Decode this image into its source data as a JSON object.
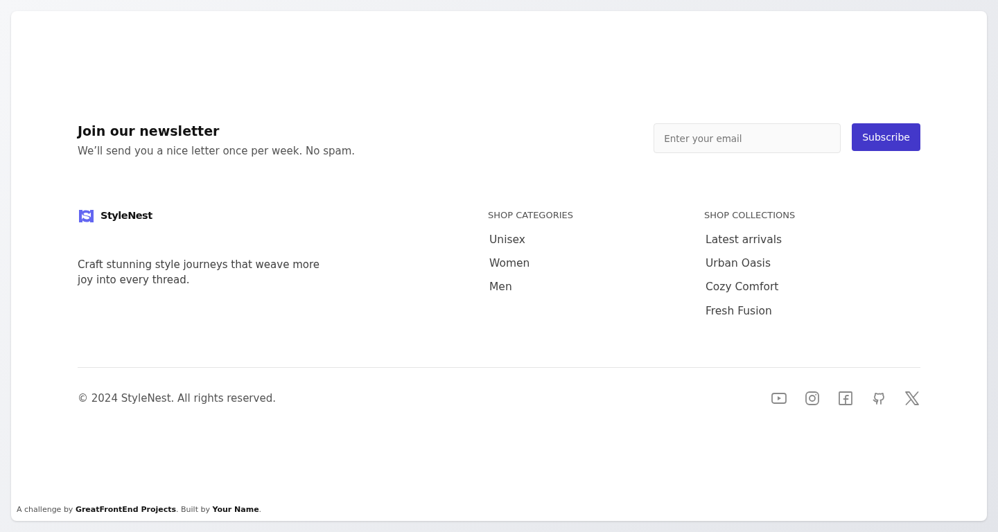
{
  "newsletter": {
    "title": "Join our newsletter",
    "subtitle": "We’ll send you a nice letter once per week. No spam.",
    "email": {
      "placeholder": "Enter your email"
    },
    "button": "Subscribe"
  },
  "brand": {
    "name": "StyleNest",
    "tagline": "Craft stunning style journeys that weave more joy into every thread."
  },
  "columns": [
    {
      "heading": "SHOP CATEGORIES",
      "links": [
        "Unisex",
        "Women",
        "Men"
      ]
    },
    {
      "heading": "SHOP COLLECTIONS",
      "links": [
        "Latest arrivals",
        "Urban Oasis",
        "Cozy Comfort",
        "Fresh Fusion"
      ]
    }
  ],
  "copyright": "© 2024 StyleNest. All rights reserved.",
  "social": [
    {
      "kind": "youtube"
    },
    {
      "kind": "instagram"
    },
    {
      "kind": "facebook"
    },
    {
      "kind": "github"
    },
    {
      "kind": "x"
    }
  ],
  "attribution": [
    {
      "kind": "text",
      "text": "A challenge by "
    },
    {
      "kind": "link",
      "text": "GreatFrontEnd Projects"
    },
    {
      "kind": "text",
      "text": ". Built by "
    },
    {
      "kind": "link",
      "text": "Your Name"
    },
    {
      "kind": "text",
      "text": "."
    }
  ]
}
